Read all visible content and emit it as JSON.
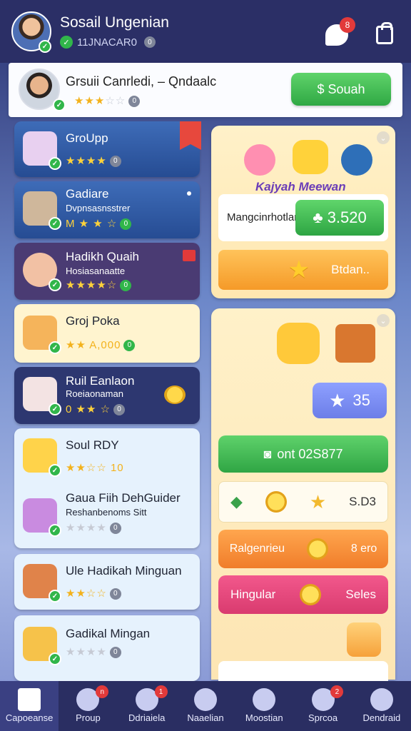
{
  "header": {
    "title": "Sosail Ungenian",
    "subtitle": "11JNACAR0",
    "subtitle_badge": "0",
    "chat_badge": "8"
  },
  "profile": {
    "name": "Grsuii Canrledi, – Qndaalc",
    "stars_filled": "★★★",
    "stars_empty": "☆☆",
    "badge": "0",
    "search_label": "$ Souah"
  },
  "groups": [
    {
      "title": "GroUpp",
      "sub": "",
      "stars": "★★★★",
      "badge": "0"
    },
    {
      "title": "Gadiare",
      "sub": "Dvpnsasnsstrer",
      "stars": "M ★ ★ ☆",
      "badge": "0"
    },
    {
      "title": "Hadikh Quaih",
      "sub": "Hosiasanaatte",
      "stars": "★★★★☆",
      "badge": "0"
    },
    {
      "title": "Groj Poka",
      "sub": "",
      "stars": "★★ A,000",
      "badge": "0"
    },
    {
      "title": "Ruil Eanlaon",
      "sub": "Roeiaonaman",
      "stars": "0 ★★ ☆",
      "badge": "0"
    },
    {
      "title": "Soul RDY",
      "sub": "",
      "stars": "★★☆☆ 10",
      "badge": ""
    },
    {
      "title": "Gaua Fiih DehGuider",
      "sub": "Reshanbenoms Sitt",
      "stars": "★★★★",
      "badge": "0"
    },
    {
      "title": "Ule Hadikah Minguan",
      "sub": "",
      "stars": "★★☆☆",
      "badge": "0"
    },
    {
      "title": "Gadikal Mingan",
      "sub": "",
      "stars": "★★★★",
      "badge": "0"
    }
  ],
  "promo": {
    "banner_text": "Kajyah Meewan",
    "field_label": "Mangcinrhotlar",
    "amount": "3.520",
    "button_label": "Btdan.."
  },
  "rewards": {
    "stars_count": "35",
    "green_label": "ont 02S877",
    "row1_value": "S.D3",
    "row2_label": "Ralgenrieu",
    "row2_value": "8 ero",
    "row3_label": "Hingular",
    "row3_value": "Seles"
  },
  "nav": [
    {
      "label": "Capoeanse",
      "badge": ""
    },
    {
      "label": "Proup",
      "badge": "n"
    },
    {
      "label": "Ddriaiela",
      "badge": "1"
    },
    {
      "label": "Naaelian",
      "badge": ""
    },
    {
      "label": "Moostian",
      "badge": ""
    },
    {
      "label": "Sprcoa",
      "badge": "2"
    },
    {
      "label": "Dendraid",
      "badge": ""
    }
  ]
}
